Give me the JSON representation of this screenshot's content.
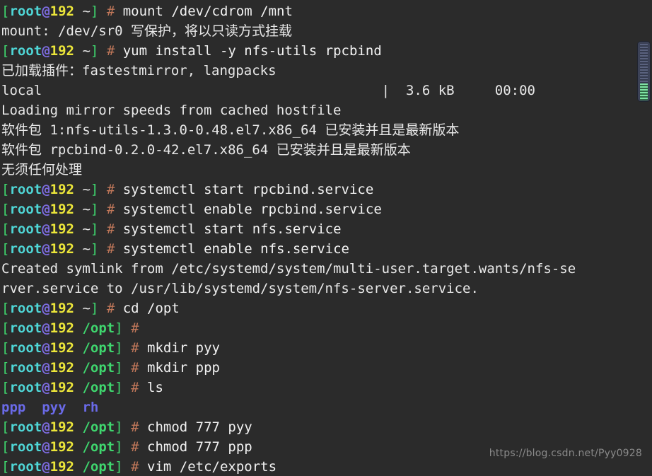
{
  "terminal": {
    "background_color": "#2b2b2b",
    "foreground_color": "#e8e8e8",
    "colors": {
      "bracket_green": "#3fd66e",
      "user_cyan": "#4fd6d6",
      "at_purple": "#7d6ce0",
      "host_yellow": "#ece63a",
      "hash_brown": "#c2785a",
      "dir_blue": "#6a6ae8",
      "watermark_grey": "#8a8a8a",
      "scrollbar_thumb": "#3c4257",
      "scrollbar_marker_green": "#7fe3a4"
    },
    "prompt": {
      "open_bracket": "[",
      "user": "root",
      "at": "@",
      "host": "192",
      "cwd_home": "~",
      "cwd_opt": "/opt",
      "close_bracket": "]",
      "hash": "#"
    },
    "lines": [
      {
        "type": "prompt",
        "cwd": "~",
        "command": " mount /dev/cdrom /mnt"
      },
      {
        "type": "output",
        "text": "mount: /dev/sr0 写保护，将以只读方式挂载"
      },
      {
        "type": "prompt",
        "cwd": "~",
        "command": " yum install -y nfs-utils rpcbind"
      },
      {
        "type": "output",
        "text": "已加载插件：fastestmirror, langpacks"
      },
      {
        "type": "output",
        "text": "local                                          |  3.6 kB     00:00"
      },
      {
        "type": "output",
        "text": "Loading mirror speeds from cached hostfile"
      },
      {
        "type": "output",
        "text": "软件包 1:nfs-utils-1.3.0-0.48.el7.x86_64 已安装并且是最新版本"
      },
      {
        "type": "output",
        "text": "软件包 rpcbind-0.2.0-42.el7.x86_64 已安装并且是最新版本"
      },
      {
        "type": "output",
        "text": "无须任何处理"
      },
      {
        "type": "prompt",
        "cwd": "~",
        "command": " systemctl start rpcbind.service"
      },
      {
        "type": "prompt",
        "cwd": "~",
        "command": " systemctl enable rpcbind.service"
      },
      {
        "type": "prompt",
        "cwd": "~",
        "command": " systemctl start nfs.service"
      },
      {
        "type": "prompt",
        "cwd": "~",
        "command": " systemctl enable nfs.service"
      },
      {
        "type": "output",
        "text": "Created symlink from /etc/systemd/system/multi-user.target.wants/nfs-se"
      },
      {
        "type": "output",
        "text": "rver.service to /usr/lib/systemd/system/nfs-server.service."
      },
      {
        "type": "prompt",
        "cwd": "~",
        "command": " cd /opt"
      },
      {
        "type": "prompt",
        "cwd": "/opt",
        "command": ""
      },
      {
        "type": "prompt",
        "cwd": "/opt",
        "command": " mkdir pyy"
      },
      {
        "type": "prompt",
        "cwd": "/opt",
        "command": " mkdir ppp"
      },
      {
        "type": "prompt",
        "cwd": "/opt",
        "command": " ls"
      },
      {
        "type": "listing",
        "entries": [
          "ppp",
          "pyy",
          "rh"
        ]
      },
      {
        "type": "prompt",
        "cwd": "/opt",
        "command": " chmod 777 pyy"
      },
      {
        "type": "prompt",
        "cwd": "/opt",
        "command": " chmod 777 ppp"
      },
      {
        "type": "prompt",
        "cwd": "/opt",
        "command": " vim /etc/exports"
      }
    ]
  },
  "watermark": {
    "text": "https://blog.csdn.net/Pyy0928"
  },
  "scrollbar": {
    "name": "vertical-scrollbar"
  }
}
